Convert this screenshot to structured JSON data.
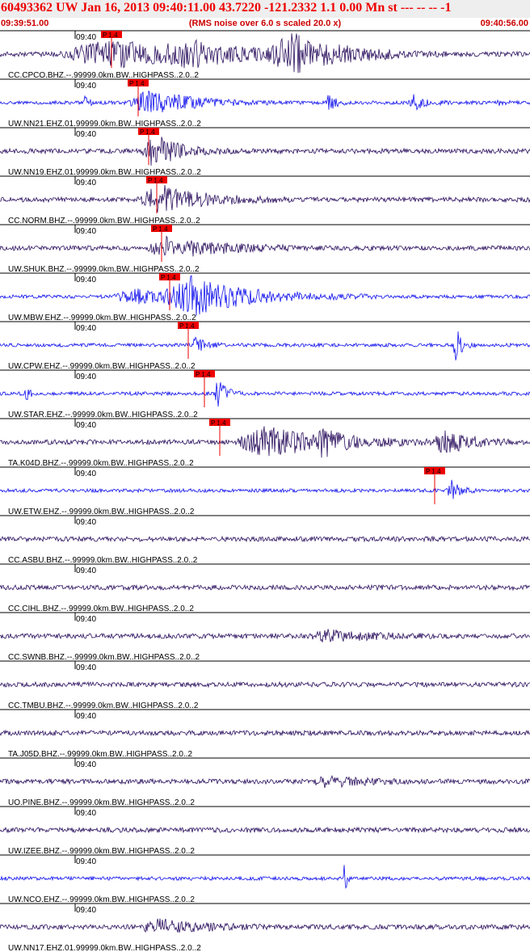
{
  "header": {
    "title": "60493362 UW Jan 16, 2013 09:40:11.00   43.7220 -121.2332  1.1 0.00 Mn st --- -- --   -1",
    "start_time": "09:39:51.00",
    "scaling_note": "(RMS noise over 6.0 s scaled 20.0 x)",
    "end_time": "09:40:56.00"
  },
  "colors": {
    "dark_trace": "#2a0f5e",
    "blue_trace": "#1010ee",
    "pick": "#ee0000"
  },
  "chart_data": {
    "type": "line",
    "time_range": [
      "09:39:51.00",
      "09:40:56.00"
    ],
    "time_tick_label": "09:40",
    "pick_label": "P 1.4",
    "series": [
      {
        "name": "CC.CPCO.BHZ.--.99999.0km.BW..HIGHPASS..2.0..2",
        "color": "dark",
        "pick": 0.21,
        "events": [
          [
            0.2,
            0.22,
            0.8
          ],
          [
            0.55,
            0.12,
            1.0
          ],
          [
            0.35,
            0.1,
            0.5
          ]
        ]
      },
      {
        "name": "UW.NN21.EHZ.01.99999.0km.BW..HIGHPASS..2.0..2",
        "color": "blue",
        "pick": 0.26,
        "events": [
          [
            0.28,
            0.1,
            0.7
          ],
          [
            0.62,
            0.02,
            0.4
          ],
          [
            0.78,
            0.03,
            0.4
          ],
          [
            0.94,
            0.01,
            0.3
          ],
          [
            0.16,
            0.01,
            0.3
          ]
        ]
      },
      {
        "name": "UW.NN19.EHZ.01.99999.0km.BW..HIGHPASS..2.0..2",
        "color": "dark",
        "pick": 0.28,
        "events": [
          [
            0.29,
            0.06,
            1.0
          ]
        ]
      },
      {
        "name": "CC.NORM.BHZ.--.99999.0km.BW..HIGHPASS..2.0..2",
        "color": "dark",
        "pick": 0.295,
        "events": [
          [
            0.3,
            0.1,
            0.8
          ]
        ]
      },
      {
        "name": "UW.SHUK.BHZ.--.99999.0km.BW..HIGHPASS..2.0..2",
        "color": "dark",
        "pick": 0.305,
        "events": [
          [
            0.32,
            0.12,
            0.6
          ]
        ]
      },
      {
        "name": "UW.MBW.EHZ.--.99999.0km.BW..HIGHPASS..2.0..2",
        "color": "blue",
        "pick": 0.32,
        "events": [
          [
            0.36,
            0.14,
            1.0
          ],
          [
            0.25,
            0.1,
            0.4
          ]
        ]
      },
      {
        "name": "UW.CPW.EHZ.--.99999.0km.BW..HIGHPASS..2.0..2",
        "color": "blue",
        "pick": 0.355,
        "events": [
          [
            0.37,
            0.02,
            0.5
          ],
          [
            0.86,
            0.015,
            1.0
          ]
        ]
      },
      {
        "name": "UW.STAR.EHZ.--.99999.0km.BW..HIGHPASS..2.0..2",
        "color": "blue",
        "pick": 0.385,
        "events": [
          [
            0.41,
            0.02,
            0.8
          ],
          [
            0.05,
            0.01,
            0.3
          ]
        ]
      },
      {
        "name": "TA.K04D.BHZ.--.99999.0km.BW..HIGHPASS..2.0..2",
        "color": "dark",
        "pick": 0.415,
        "events": [
          [
            0.5,
            0.16,
            0.8
          ],
          [
            0.84,
            0.06,
            0.6
          ],
          [
            0.61,
            0.03,
            0.6
          ]
        ]
      },
      {
        "name": "UW.ETW.EHZ.--.99999.0km.BW..HIGHPASS..2.0..2",
        "color": "blue",
        "pick": 0.82,
        "events": [
          [
            0.85,
            0.02,
            0.6
          ]
        ]
      },
      {
        "name": "CC.ASBU.BHZ.--.99999.0km.BW..HIGHPASS..2.0..2",
        "color": "dark",
        "pick": null,
        "events": []
      },
      {
        "name": "CC.CIHL.BHZ.--.99999.0km.BW..HIGHPASS..2.0..2",
        "color": "dark",
        "pick": null,
        "events": []
      },
      {
        "name": "CC.SWNB.BHZ.--.99999.0km.BW..HIGHPASS..2.0..2",
        "color": "dark",
        "pick": null,
        "events": [
          [
            0.62,
            0.1,
            0.3
          ]
        ]
      },
      {
        "name": "CC.TMBU.BHZ.--.99999.0km.BW..HIGHPASS..2.0..2",
        "color": "dark",
        "pick": null,
        "events": []
      },
      {
        "name": "TA.J05D.BHZ.--.99999.0km.BW..HIGHPASS..2.0..2",
        "color": "dark",
        "pick": null,
        "events": []
      },
      {
        "name": "UO.PINE.BHZ.--.99999.0km.BW..HIGHPASS..2.0..2",
        "color": "dark",
        "pick": null,
        "events": [
          [
            0.62,
            0.08,
            0.3
          ]
        ]
      },
      {
        "name": "UW.IZEE.BHZ.--.99999.0km.BW..HIGHPASS..2.0..2",
        "color": "dark",
        "pick": null,
        "events": []
      },
      {
        "name": "UW.NCO.EHZ.--.99999.0km.BW..HIGHPASS..2.0..2",
        "color": "blue",
        "pick": null,
        "events": [
          [
            0.65,
            0.005,
            1.0
          ]
        ]
      },
      {
        "name": "UW.NN17.EHZ.01.99999.0km.BW..HIGHPASS..2.0..2",
        "color": "dark",
        "pick": null,
        "events": [
          [
            0.3,
            0.1,
            0.4
          ]
        ]
      }
    ]
  }
}
